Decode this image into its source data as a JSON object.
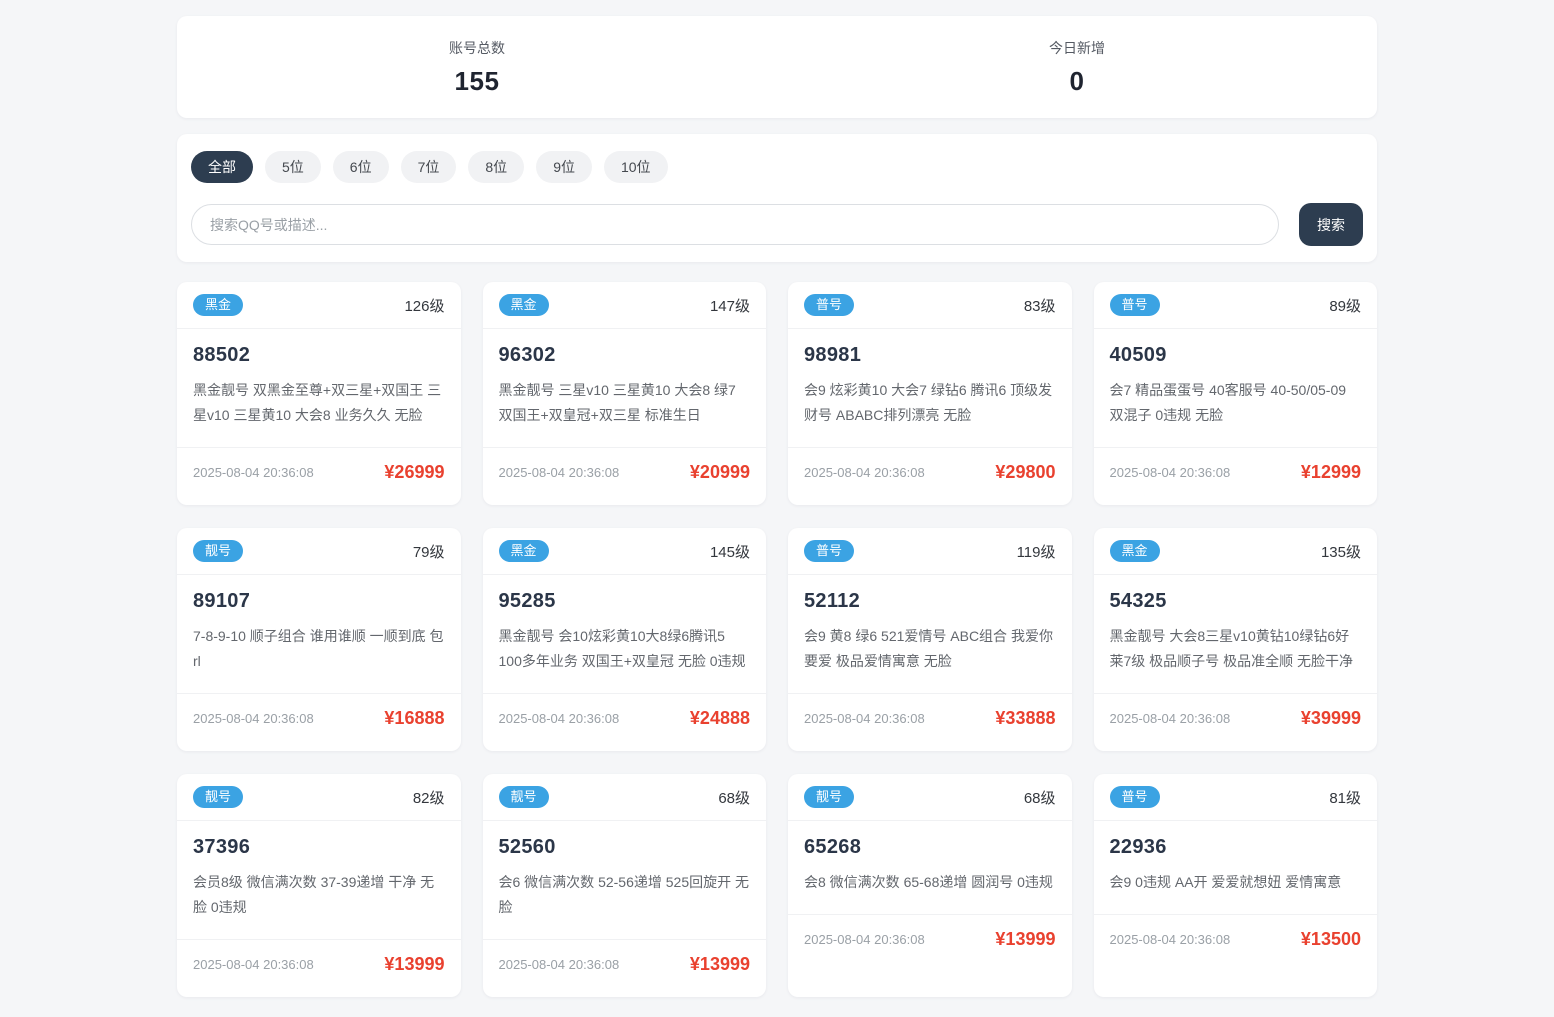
{
  "colors": {
    "badge_blue": "#3ba3e3",
    "accent_dark": "#2d3d50",
    "price_red": "#e9412f",
    "page_bg": "#f5f6f8"
  },
  "stats": {
    "total_label": "账号总数",
    "total_value": "155",
    "today_label": "今日新增",
    "today_value": "0"
  },
  "filters": {
    "tabs": [
      {
        "label": "全部",
        "active": true
      },
      {
        "label": "5位",
        "active": false
      },
      {
        "label": "6位",
        "active": false
      },
      {
        "label": "7位",
        "active": false
      },
      {
        "label": "8位",
        "active": false
      },
      {
        "label": "9位",
        "active": false
      },
      {
        "label": "10位",
        "active": false
      }
    ],
    "search_placeholder": "搜索QQ号或描述...",
    "search_button": "搜索"
  },
  "cards": [
    {
      "badge": "黑金",
      "level": "126级",
      "number": "88502",
      "desc": "黑金靓号 双黑金至尊+双三星+双国王 三星v10 三星黄10 大会8 业务久久 无脸",
      "time": "2025-08-04 20:36:08",
      "price": "¥26999"
    },
    {
      "badge": "黑金",
      "level": "147级",
      "number": "96302",
      "desc": "黑金靓号 三星v10 三星黄10 大会8 绿7 双国王+双皇冠+双三星 标准生日",
      "time": "2025-08-04 20:36:08",
      "price": "¥20999"
    },
    {
      "badge": "普号",
      "level": "83级",
      "number": "98981",
      "desc": "会9 炫彩黄10 大会7 绿钻6 腾讯6 顶级发财号 ABABC排列漂亮 无脸",
      "time": "2025-08-04 20:36:08",
      "price": "¥29800"
    },
    {
      "badge": "普号",
      "level": "89级",
      "number": "40509",
      "desc": "会7 精品蛋蛋号 40客服号 40-50/05-09 双混子 0违规 无脸",
      "time": "2025-08-04 20:36:08",
      "price": "¥12999"
    },
    {
      "badge": "靓号",
      "level": "79级",
      "number": "89107",
      "desc": "7-8-9-10 顺子组合 谁用谁顺 一顺到底 包rl",
      "time": "2025-08-04 20:36:08",
      "price": "¥16888"
    },
    {
      "badge": "黑金",
      "level": "145级",
      "number": "95285",
      "desc": "黑金靓号 会10炫彩黄10大8绿6腾讯5 100多年业务 双国王+双皇冠 无脸 0违规",
      "time": "2025-08-04 20:36:08",
      "price": "¥24888"
    },
    {
      "badge": "普号",
      "level": "119级",
      "number": "52112",
      "desc": "会9 黄8 绿6 521爱情号 ABC组合 我爱你要爱 极品爱情寓意 无脸",
      "time": "2025-08-04 20:36:08",
      "price": "¥33888"
    },
    {
      "badge": "黑金",
      "level": "135级",
      "number": "54325",
      "desc": "黑金靓号 大会8三星v10黄钻10绿钻6好莱7级 极品顺子号 极品准全顺 无脸干净",
      "time": "2025-08-04 20:36:08",
      "price": "¥39999"
    },
    {
      "badge": "靓号",
      "level": "82级",
      "number": "37396",
      "desc": "会员8级 微信满次数 37-39递增 干净 无脸 0违规",
      "time": "2025-08-04 20:36:08",
      "price": "¥13999"
    },
    {
      "badge": "靓号",
      "level": "68级",
      "number": "52560",
      "desc": "会6 微信满次数 52-56递增 525回旋开 无脸",
      "time": "2025-08-04 20:36:08",
      "price": "¥13999"
    },
    {
      "badge": "靓号",
      "level": "68级",
      "number": "65268",
      "desc": "会8 微信满次数 65-68递增 圆润号 0违规",
      "time": "2025-08-04 20:36:08",
      "price": "¥13999"
    },
    {
      "badge": "普号",
      "level": "81级",
      "number": "22936",
      "desc": "会9 0违规 AA开 爱爱就想妞 爱情寓意",
      "time": "2025-08-04 20:36:08",
      "price": "¥13500"
    }
  ]
}
